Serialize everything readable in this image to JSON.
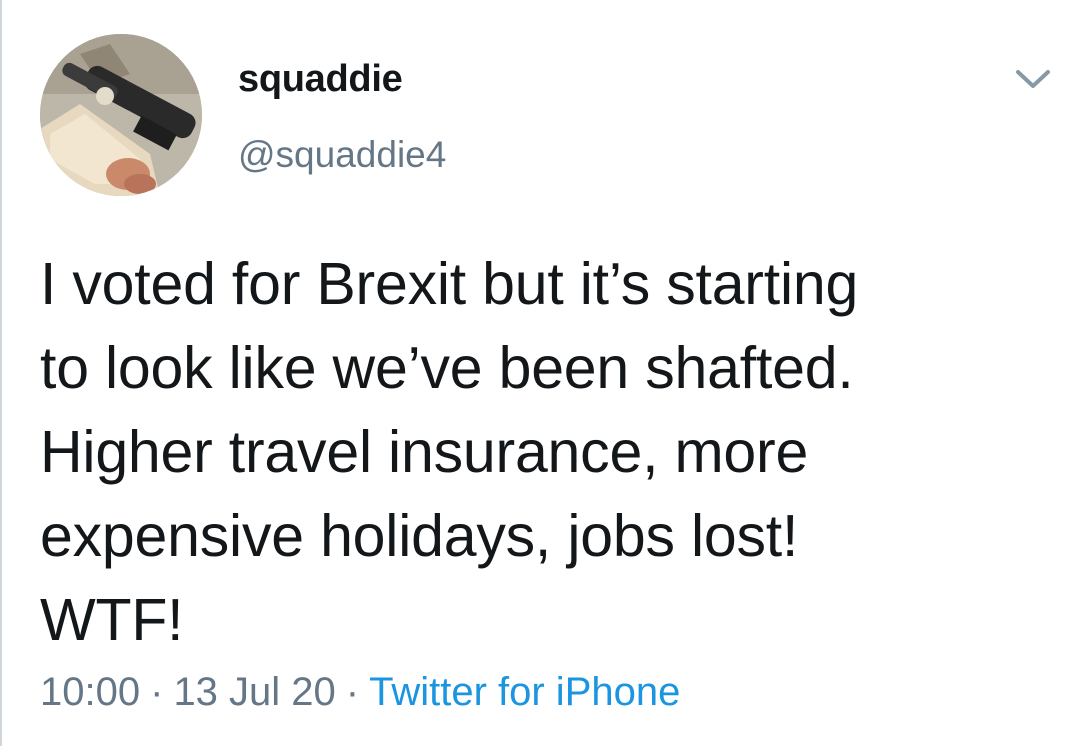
{
  "tweet": {
    "display_name": "squaddie",
    "handle": "@squaddie4",
    "text": "I voted for Brexit but it’s starting\nto look like we’ve been shafted.\nHigher travel insurance, more\nexpensive holidays, jobs lost!\nWTF!",
    "time": "10:00",
    "date": "13 Jul 20",
    "separator": "·",
    "source": "Twitter for iPhone"
  },
  "icons": {
    "menu": "chevron-down-icon",
    "avatar": "avatar-rifle-image"
  },
  "colors": {
    "text": "#14171a",
    "secondary": "#657786",
    "link": "#1b95e0",
    "background": "#ffffff"
  }
}
